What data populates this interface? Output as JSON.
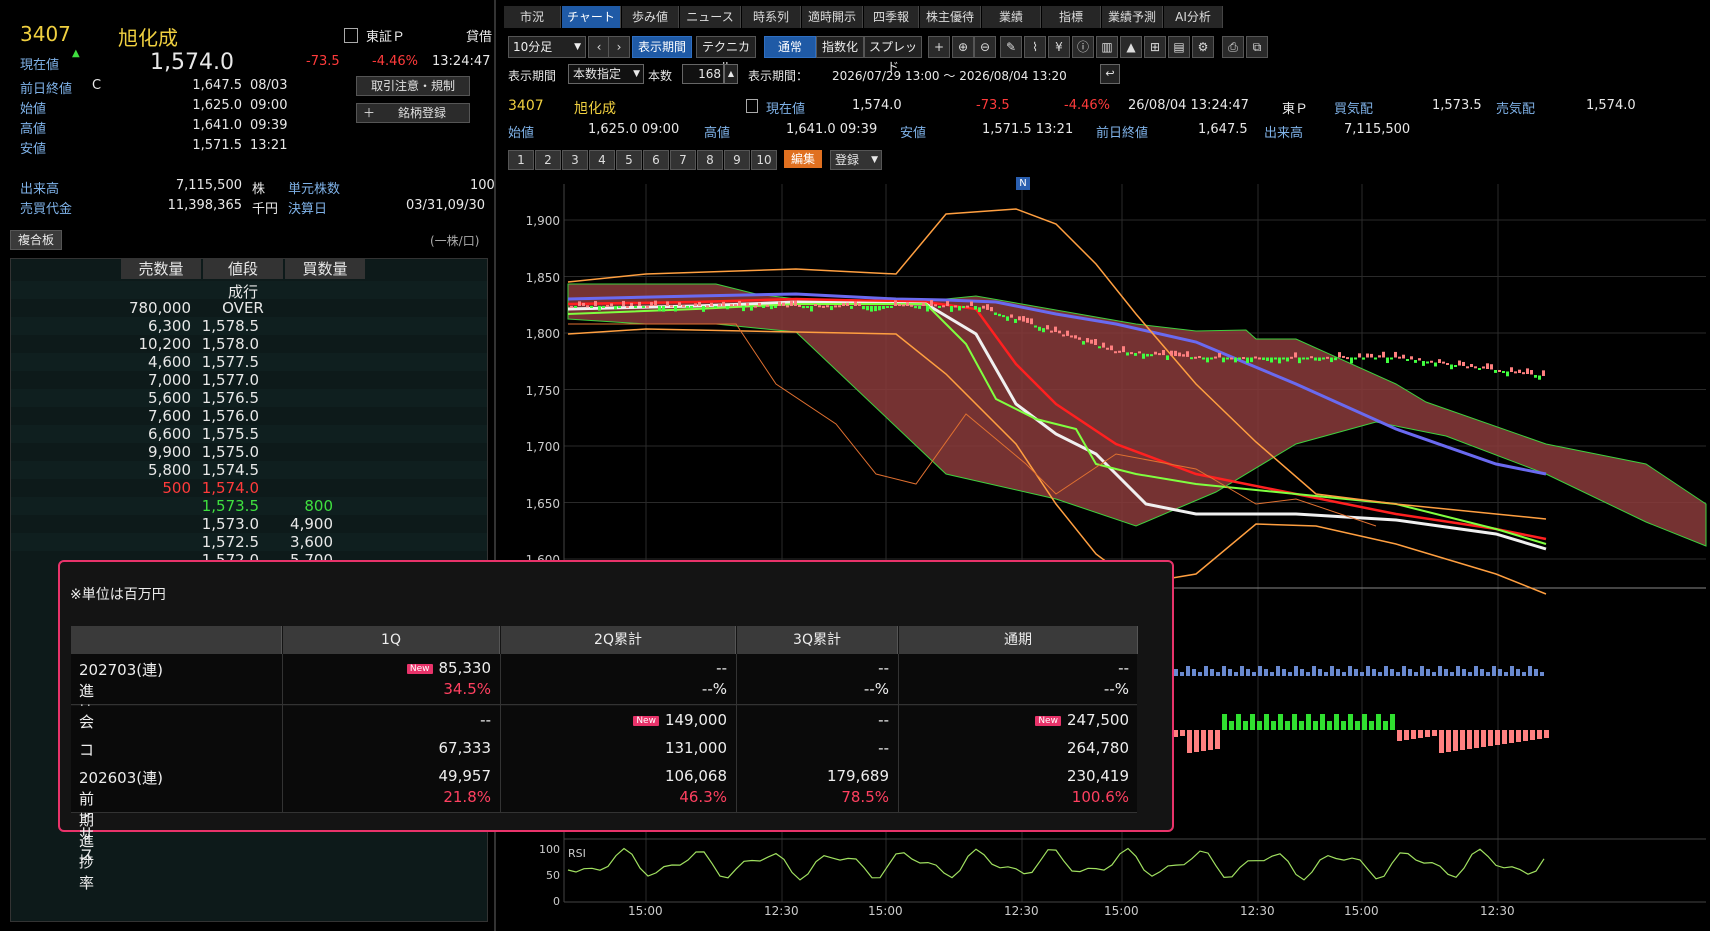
{
  "stock": {
    "code": "3407",
    "name": "旭化成",
    "market": "東証Ｐ",
    "market_cut": "貸借",
    "current_label": "現在値",
    "current_price": "1,574.0",
    "change": "-73.5",
    "change_pct": "-4.46%",
    "time": "13:24:47",
    "prev_close_label": "前日終値",
    "prev_close_flag": "C",
    "prev_close": "1,647.5",
    "prev_close_date": "08/03",
    "open_label": "始値",
    "open": "1,625.0",
    "open_time": "09:00",
    "high_label": "高値",
    "high": "1,641.0",
    "high_time": "09:39",
    "low_label": "安値",
    "low": "1,571.5",
    "low_time": "13:21",
    "volume_label": "出来高",
    "volume": "7,115,500",
    "volume_unit": "株",
    "unit_label": "単元株数",
    "unit_value": "100",
    "turnover_label": "売買代金",
    "turnover": "11,398,365",
    "turnover_unit": "千円",
    "settle_label": "決算日",
    "settle_value": "03/31,09/30"
  },
  "buttons": {
    "caution": "取引注意・規制",
    "register": "銘柄登録"
  },
  "book": {
    "tab": "複合板",
    "unit_note": "(一株/口)",
    "headers": [
      "売数量",
      "値段",
      "買数量"
    ],
    "rows": [
      {
        "sell": "",
        "price": "成行",
        "buy": ""
      },
      {
        "sell": "780,000",
        "price": "OVER",
        "buy": ""
      },
      {
        "sell": "6,300",
        "price": "1,578.5",
        "buy": ""
      },
      {
        "sell": "10,200",
        "price": "1,578.0",
        "buy": ""
      },
      {
        "sell": "4,600",
        "price": "1,577.5",
        "buy": ""
      },
      {
        "sell": "7,000",
        "price": "1,577.0",
        "buy": ""
      },
      {
        "sell": "5,600",
        "price": "1,576.5",
        "buy": ""
      },
      {
        "sell": "7,600",
        "price": "1,576.0",
        "buy": ""
      },
      {
        "sell": "6,600",
        "price": "1,575.5",
        "buy": ""
      },
      {
        "sell": "9,900",
        "price": "1,575.0",
        "buy": ""
      },
      {
        "sell": "5,800",
        "price": "1,574.5",
        "buy": ""
      },
      {
        "sell": "500",
        "price": "1,574.0",
        "buy": ""
      },
      {
        "sell": "",
        "price": "1,573.5",
        "buy": "800"
      },
      {
        "sell": "",
        "price": "1,573.0",
        "buy": "4,900"
      },
      {
        "sell": "",
        "price": "1,572.5",
        "buy": "3,600"
      },
      {
        "sell": "",
        "price": "1,572.0",
        "buy": "5,700"
      }
    ]
  },
  "tabs": [
    "市況",
    "チャート",
    "歩み値",
    "ニュース",
    "時系列",
    "適時開示",
    "四季報",
    "株主優待",
    "業績",
    "指標",
    "業績予測",
    "AI分析"
  ],
  "toolbar": {
    "interval": "10分足",
    "display_period": "表示期間",
    "technical": "テクニカル",
    "normal": "通常",
    "indexed": "指数化",
    "spread": "スプレッド",
    "period_label": "表示期間",
    "period_mode": "本数指定",
    "count_label": "本数",
    "count": "168",
    "range_label": "表示期間：",
    "range": "2026/07/29 13:00 ～ 2026/08/04 13:20"
  },
  "chart_header": {
    "current_label": "現在値",
    "current": "1,574.0",
    "change": "-73.5",
    "change_pct": "-4.46%",
    "datetime": "26/08/04  13:24:47",
    "market": "東Ｐ",
    "bid_label": "買気配",
    "bid": "1,573.5",
    "ask_label": "売気配",
    "ask": "1,574.0",
    "open_label": "始値",
    "open": "1,625.0  09:00",
    "high_label": "高値",
    "high": "1,641.0  09:39",
    "low_label": "安値",
    "low": "1,571.5  13:21",
    "prev_label": "前日終値",
    "prev": "1,647.5",
    "volume_label": "出来高",
    "volume": "7,115,500"
  },
  "chart_tabs": [
    "1",
    "2",
    "3",
    "4",
    "5",
    "6",
    "7",
    "8",
    "9",
    "10"
  ],
  "chart_tab_edit": "編集",
  "chart_tab_register": "登録",
  "news_marker": "N",
  "price_axis": [
    "1,900",
    "1,850",
    "1,800",
    "1,750",
    "1,700",
    "1,650",
    "1,600"
  ],
  "rsi_label": "RSI",
  "rsi_axis": [
    "100",
    "50",
    "0"
  ],
  "time_axis": [
    "15:00",
    "12:30",
    "15:00",
    "12:30",
    "15:00",
    "12:30",
    "15:00",
    "12:30"
  ],
  "overlay": {
    "note": "※単位は百万円",
    "headers": [
      "",
      "1Q",
      "2Q累計",
      "3Q累計",
      "通期"
    ],
    "new_badge": "New",
    "rows": [
      {
        "label": "202703(連)",
        "label2": "進捗率",
        "cells": [
          {
            "v": "85,330",
            "p": "34.5%",
            "new": true
          },
          {
            "v": "--",
            "p": "--%"
          },
          {
            "v": "--",
            "p": "--%"
          },
          {
            "v": "--",
            "p": "--%"
          }
        ]
      },
      {
        "label": "会社予想",
        "cells": [
          {
            "v": "--"
          },
          {
            "v": "149,000",
            "new": true
          },
          {
            "v": "--"
          },
          {
            "v": "247,500",
            "new": true
          }
        ]
      },
      {
        "label": "コンセンサス",
        "cells": [
          {
            "v": "67,333"
          },
          {
            "v": "131,000"
          },
          {
            "v": "--"
          },
          {
            "v": "264,780"
          }
        ]
      },
      {
        "label": "202603(連)",
        "label2": "前期進捗率",
        "cells": [
          {
            "v": "49,957",
            "p": "21.8%"
          },
          {
            "v": "106,068",
            "p": "46.3%"
          },
          {
            "v": "179,689",
            "p": "78.5%"
          },
          {
            "v": "230,419",
            "p": "100.6%"
          }
        ]
      }
    ]
  }
}
